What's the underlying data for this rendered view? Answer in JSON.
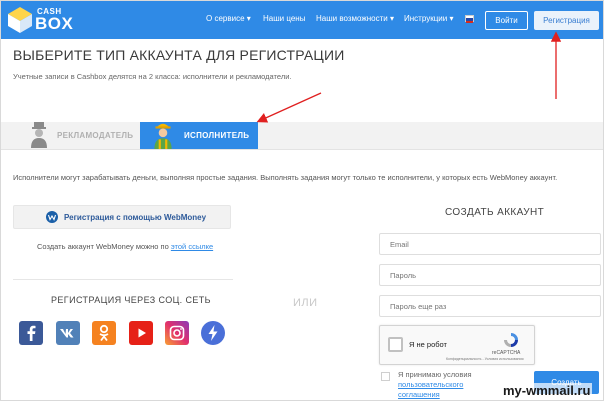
{
  "header": {
    "logo_top": "CASH",
    "logo_bottom": "BOX",
    "nav": [
      {
        "label": "О сервисе",
        "has_dropdown": true
      },
      {
        "label": "Наши цены",
        "has_dropdown": false
      },
      {
        "label": "Наши возможности",
        "has_dropdown": true
      },
      {
        "label": "Инструкции",
        "has_dropdown": true
      }
    ],
    "login_label": "Войти",
    "register_label": "Регистрация",
    "language_flag": "ru-flag-icon"
  },
  "page": {
    "title": "ВЫБЕРИТЕ ТИП АККАУНТА ДЛЯ РЕГИСТРАЦИИ",
    "subtitle": "Учетные записи в Cashbox делятся на 2 класса: исполнители и рекламодатели."
  },
  "tabs": [
    {
      "label": "РЕКЛАМОДАТЕЛЬ",
      "active": false,
      "icon": "advertiser-avatar-icon"
    },
    {
      "label": "ИСПОЛНИТЕЛЬ",
      "active": true,
      "icon": "worker-avatar-icon"
    }
  ],
  "info_text": "Исполнители могут зарабатывать деньги, выполняя простые задания. Выполнять задания могут только те исполнители, у которых есть WebMoney аккаунт.",
  "webmoney": {
    "button_label": "Регистрация с помощью WebMoney",
    "note_prefix": "Создать аккаунт WebMoney можно по",
    "note_link": "этой ссылке"
  },
  "social": {
    "title": "РЕГИСТРАЦИЯ ЧЕРЕЗ СОЦ. СЕТЬ",
    "networks": [
      "facebook-icon",
      "vk-icon",
      "odnoklassniki-icon",
      "youtube-icon",
      "instagram-icon",
      "blitz-icon"
    ]
  },
  "or_label": "ИЛИ",
  "form": {
    "title": "СОЗДАТЬ АККАУНТ",
    "email_placeholder": "Email",
    "password_placeholder": "Пароль",
    "password_repeat_placeholder": "Пароль еще раз",
    "captcha_label": "Я не робот",
    "captcha_brand": "reCAPTCHA",
    "captcha_terms": "Конфиденциальность - Условия использования",
    "agree_prefix": "Я принимаю условия",
    "agree_link": "пользовательского соглашения",
    "submit_label": "Создать"
  },
  "watermark": "my-wmmail.ru",
  "colors": {
    "brand_blue": "#2f8ae6",
    "arrow_red": "#e02020"
  }
}
